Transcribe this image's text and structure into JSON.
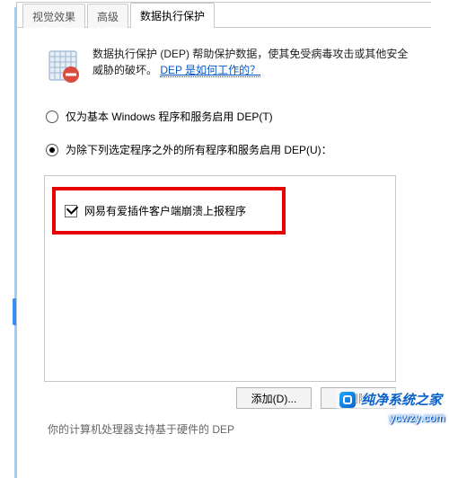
{
  "tabs": {
    "t0": "视觉效果",
    "t1": "高级",
    "t2": "数据执行保护"
  },
  "intro": {
    "text_before_link": "数据执行保护 (DEP) 帮助保护数据，使其免受病毒攻击或其他安全威胁的破坏。",
    "link": "DEP 是如何工作的？"
  },
  "options": {
    "opt_basic": "仅为基本 Windows 程序和服务启用 DEP(T)",
    "opt_all_except": "为除下列选定程序之外的所有程序和服务启用 DEP(U)："
  },
  "list": {
    "items": {
      "i0": "网易有爱插件客户端崩溃上报程序"
    }
  },
  "buttons": {
    "add": "添加(D)...",
    "remove": "删除"
  },
  "footer": "你的计算机处理器支持基于硬件的 DEP",
  "watermark": {
    "name": "纯净系统之家",
    "url": "ycwzy.com"
  }
}
